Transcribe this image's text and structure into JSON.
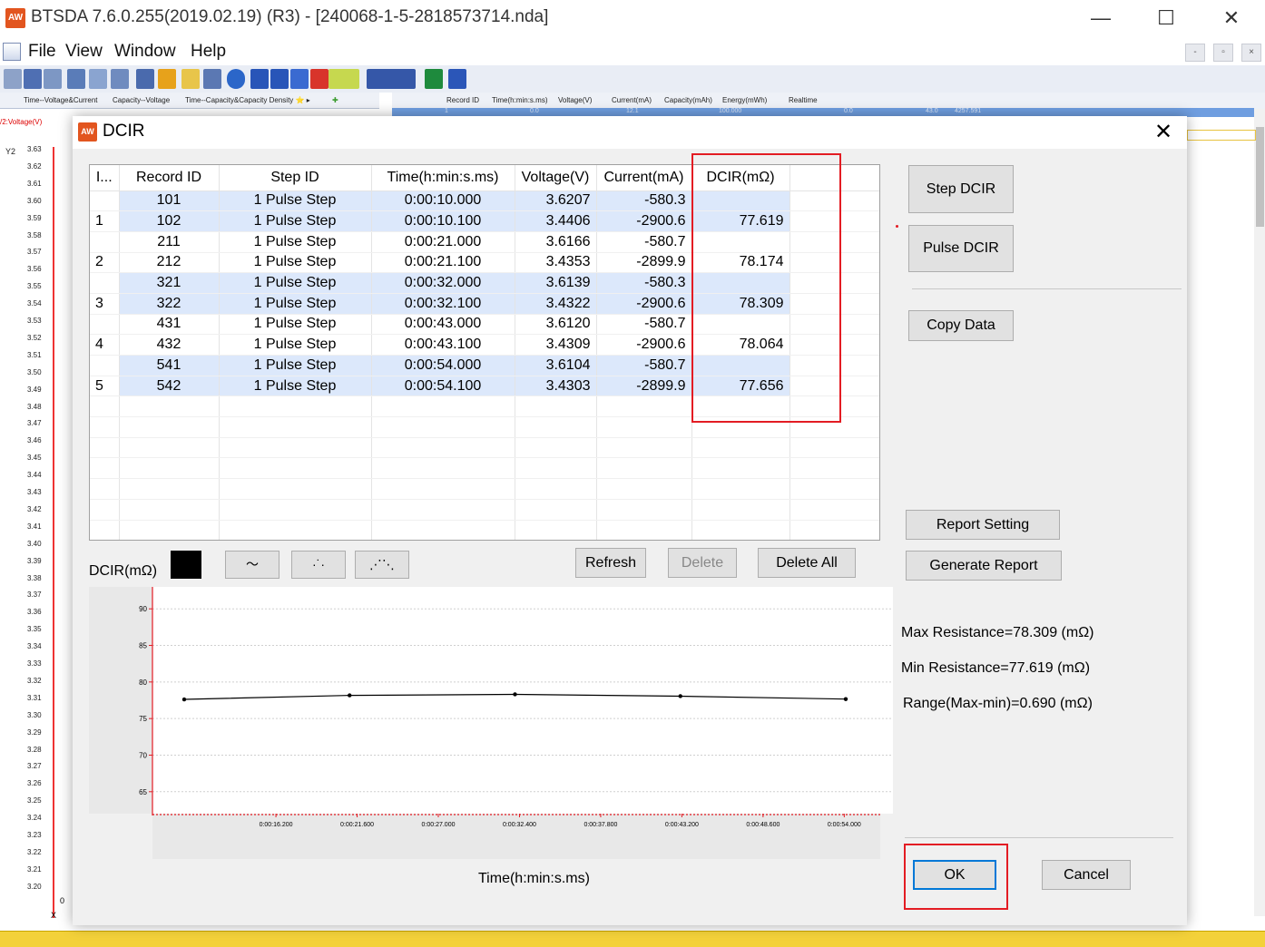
{
  "app": {
    "icon_text": "AW",
    "title": "BTSDA 7.6.0.255(2019.02.19) (R3) - [240068-1-5-2818573714.nda]",
    "window_buttons": {
      "minimize": "—",
      "maximize": "☐",
      "close": "✕"
    }
  },
  "menu": {
    "file": "File",
    "view": "View",
    "window": "Window",
    "help": "Help",
    "mdi_min": "-",
    "mdi_restore": "▫",
    "mdi_close": "×"
  },
  "tabs": [
    "Time--Voltage&Current",
    "Capacity--Voltage",
    "Time--Capacity&Capacity Density ⭐ ▸"
  ],
  "background_grid": {
    "headers": [
      "Record ID",
      "Time(h:min:s.ms)",
      "Voltage(V)",
      "Current(mA)",
      "Capacity(mAh)",
      "Energy(mWh)",
      "Realtime"
    ],
    "row_values": [
      "1",
      "0.0",
      "12.1",
      "100.000",
      "0.0",
      "43.0",
      "4257.591"
    ]
  },
  "background_axis": {
    "title": "/2:Voltage(V)",
    "y2_label": "Y2",
    "ticks": [
      "3.63",
      "3.62",
      "3.61",
      "3.60",
      "3.59",
      "3.58",
      "3.57",
      "3.56",
      "3.55",
      "3.54",
      "3.53",
      "3.52",
      "3.51",
      "3.50",
      "3.49",
      "3.48",
      "3.47",
      "3.46",
      "3.45",
      "3.44",
      "3.43",
      "3.42",
      "3.41",
      "3.40",
      "3.39",
      "3.38",
      "3.37",
      "3.36",
      "3.35",
      "3.34",
      "3.33",
      "3.32",
      "3.31",
      "3.30",
      "3.29",
      "3.28",
      "3.27",
      "3.26",
      "3.25",
      "3.24",
      "3.23",
      "3.22",
      "3.21",
      "3.20"
    ],
    "x_zero": "0",
    "x_label": "X"
  },
  "dialog": {
    "icon_text": "AW",
    "title": "DCIR",
    "close_symbol": "✕",
    "table": {
      "columns": [
        "I...",
        "Record ID",
        "Step ID",
        "Time(h:min:s.ms)",
        "Voltage(V)",
        "Current(mA)",
        "DCIR(mΩ)"
      ],
      "rows": [
        {
          "index": "",
          "record_id": "101",
          "step_id": "1 Pulse Step",
          "time": "0:00:10.000",
          "voltage": "3.6207",
          "current": "-580.3",
          "dcir": "",
          "highlight": true
        },
        {
          "index": "1",
          "record_id": "102",
          "step_id": "1 Pulse Step",
          "time": "0:00:10.100",
          "voltage": "3.4406",
          "current": "-2900.6",
          "dcir": "77.619",
          "highlight": true
        },
        {
          "index": "",
          "record_id": "211",
          "step_id": "1 Pulse Step",
          "time": "0:00:21.000",
          "voltage": "3.6166",
          "current": "-580.7",
          "dcir": "",
          "highlight": false
        },
        {
          "index": "2",
          "record_id": "212",
          "step_id": "1 Pulse Step",
          "time": "0:00:21.100",
          "voltage": "3.4353",
          "current": "-2899.9",
          "dcir": "78.174",
          "highlight": false
        },
        {
          "index": "",
          "record_id": "321",
          "step_id": "1 Pulse Step",
          "time": "0:00:32.000",
          "voltage": "3.6139",
          "current": "-580.3",
          "dcir": "",
          "highlight": true
        },
        {
          "index": "3",
          "record_id": "322",
          "step_id": "1 Pulse Step",
          "time": "0:00:32.100",
          "voltage": "3.4322",
          "current": "-2900.6",
          "dcir": "78.309",
          "highlight": true
        },
        {
          "index": "",
          "record_id": "431",
          "step_id": "1 Pulse Step",
          "time": "0:00:43.000",
          "voltage": "3.6120",
          "current": "-580.7",
          "dcir": "",
          "highlight": false
        },
        {
          "index": "4",
          "record_id": "432",
          "step_id": "1 Pulse Step",
          "time": "0:00:43.100",
          "voltage": "3.4309",
          "current": "-2900.6",
          "dcir": "78.064",
          "highlight": false
        },
        {
          "index": "",
          "record_id": "541",
          "step_id": "1 Pulse Step",
          "time": "0:00:54.000",
          "voltage": "3.6104",
          "current": "-580.7",
          "dcir": "",
          "highlight": true
        },
        {
          "index": "5",
          "record_id": "542",
          "step_id": "1 Pulse Step",
          "time": "0:00:54.100",
          "voltage": "3.4303",
          "current": "-2899.9",
          "dcir": "77.656",
          "highlight": true
        }
      ],
      "empty_rows": 7
    },
    "buttons": {
      "step_dcir": "Step DCIR",
      "pulse_dcir": "Pulse DCIR",
      "copy_data": "Copy Data",
      "report_setting": "Report Setting",
      "generate_report": "Generate Report",
      "refresh": "Refresh",
      "delete": "Delete",
      "delete_all": "Delete All",
      "ok": "OK",
      "cancel": "Cancel"
    },
    "style_buttons": {
      "line": "〜",
      "dots": "·˙·",
      "line_dots": "⋰⋱"
    },
    "series_color": "#000000",
    "stats": {
      "max": "Max Resistance=78.309 (mΩ)",
      "min": "Min Resistance=77.619 (mΩ)",
      "range": "Range(Max-min)=0.690 (mΩ)"
    },
    "highlight_color": "#e31c23"
  },
  "chart_data": {
    "type": "line",
    "ylabel": "DCIR(mΩ)",
    "xlabel": "Time(h:min:s.ms)",
    "ylim": [
      62,
      93
    ],
    "xlim": [
      10.1,
      54.1
    ],
    "yticks": [
      65,
      70,
      75,
      80,
      85,
      90
    ],
    "xticks": [
      "0:00:16.200",
      "0:00:21.600",
      "0:00:27.000",
      "0:00:32.400",
      "0:00:37.800",
      "0:00:43.200",
      "0:00:48.600",
      "0:00:54.000"
    ],
    "xtick_values": [
      16.2,
      21.6,
      27.0,
      32.4,
      37.8,
      43.2,
      48.6,
      54.0
    ],
    "x": [
      10.1,
      21.1,
      32.1,
      43.1,
      54.1
    ],
    "values": [
      77.619,
      78.174,
      78.309,
      78.064,
      77.656
    ],
    "grid": true,
    "line_color": "#000000",
    "axis_color": "#e31c23"
  }
}
